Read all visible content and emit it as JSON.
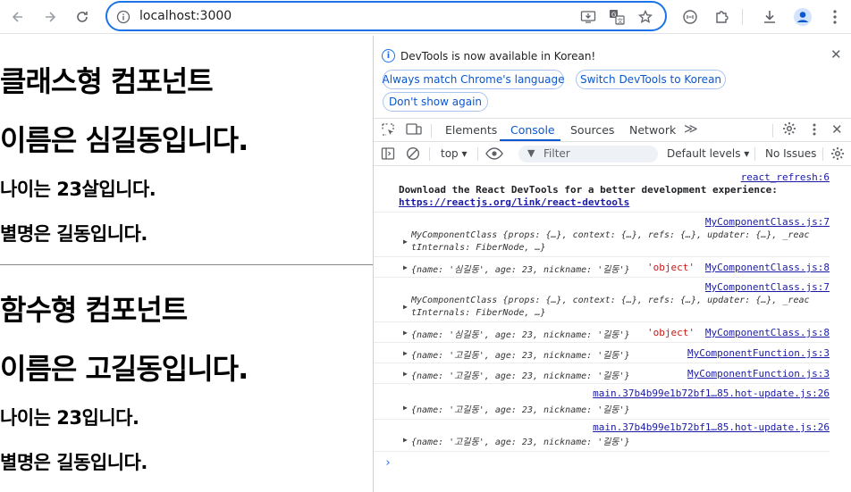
{
  "browser": {
    "url": "localhost:3000"
  },
  "page": {
    "class_heading": "클래스형 컴포넌트",
    "class_name": "이름은 심길동입니다.",
    "class_age": "나이는 23살입니다.",
    "class_nick": "별명은 길동입니다.",
    "func_heading": "함수형 컴포넌트",
    "func_name": "이름은 고길동입니다.",
    "func_age": "나이는 23입니다.",
    "func_nick": "별명은 길동입니다."
  },
  "devtools": {
    "info_text": "DevTools is now available in Korean!",
    "btn_match": "Always match Chrome's language",
    "btn_switch": "Switch DevTools to Korean",
    "btn_dont_show": "Don't show again",
    "tabs": [
      "Elements",
      "Console",
      "Sources",
      "Network"
    ],
    "context": "top",
    "filter_placeholder": "Filter",
    "levels": "Default levels",
    "issues": "No Issues"
  },
  "console": {
    "e1_src": "react_refresh:6",
    "e1_text": "Download the React DevTools for a better development experience:",
    "e1_link": "https://reactjs.org/link/react-devtools",
    "e2_src": "MyComponentClass.js:7",
    "e2_line1": "MyComponentClass {props: {…}, context: {…}, refs: {…}, updater: {…}, _reac",
    "e2_line2": "tInternals: FiberNode, …}",
    "e3_src": "MyComponentClass.js:8",
    "e3_text": "{name: '심길동', age: 23, nickname: '길동'}",
    "e3_type": "'object'",
    "e4_src": "MyComponentClass.js:7",
    "e4_line1": "MyComponentClass {props: {…}, context: {…}, refs: {…}, updater: {…}, _reac",
    "e4_line2": "tInternals: FiberNode, …}",
    "e5_src": "MyComponentClass.js:8",
    "e5_text": "{name: '심길동', age: 23, nickname: '길동'}",
    "e5_type": "'object'",
    "e6_src": "MyComponentFunction.js:3",
    "e6_text": "{name: '고길동', age: 23, nickname: '길동'}",
    "e7_src": "MyComponentFunction.js:3",
    "e7_text": "{name: '고길동', age: 23, nickname: '길동'}",
    "e8_src": "main.37b4b99e1b72bf1…85.hot-update.js:26",
    "e8_text": "{name: '고길동', age: 23, nickname: '길동'}",
    "e9_src": "main.37b4b99e1b72bf1…85.hot-update.js:26",
    "e9_text": "{name: '고길동', age: 23, nickname: '길동'}"
  },
  "colors": {
    "accent": "#1a73e8",
    "active_tab": "#0b57d0",
    "string": "#c41a16",
    "number": "#1c00cf"
  },
  "icons": [
    "back-arrow-icon",
    "forward-arrow-icon",
    "reload-icon",
    "info-icon",
    "install-app-icon",
    "translate-icon",
    "bookmark-star-icon",
    "extensions-icon",
    "download-icon",
    "profile-icon",
    "menu-icon",
    "gear-icon",
    "close-icon"
  ]
}
